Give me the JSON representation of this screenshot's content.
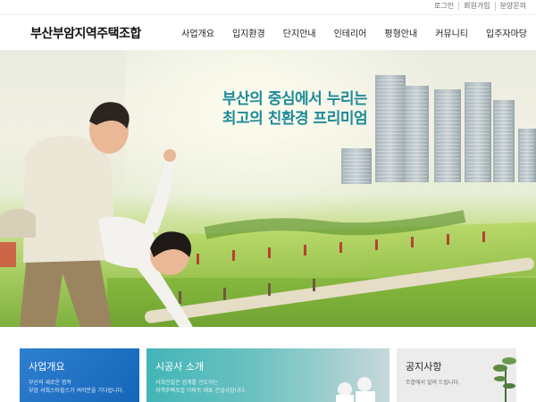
{
  "util_links": [
    "로그인",
    "회원가입",
    "분양문의"
  ],
  "logo": "부산부암지역주택조합",
  "nav": [
    "사업개요",
    "입지환경",
    "단지안내",
    "인테리어",
    "평형안내",
    "커뮤니티",
    "입주자마당"
  ],
  "hero": {
    "line1": "부산의 중심에서 누리는",
    "line2": "최고의 친환경 프리미엄"
  },
  "cards": [
    {
      "title": "사업개요",
      "desc1": "부산의 새로운 명작",
      "desc2": "부암 서희스타힐스가 여러분을 기다립니다."
    },
    {
      "title": "시공사 소개",
      "desc1": "서희건설은 업계를 선도하는",
      "desc2": "지역주택조합 아파트 대표 건설사입니다."
    },
    {
      "title": "공지사항",
      "desc1": "조합에서 알려 드립니다.",
      "desc2": ""
    }
  ],
  "colors": {
    "accent": "#1d8a9a",
    "card1": "#2f7fd1",
    "card2": "#43b5b7",
    "card3": "#ececec"
  }
}
